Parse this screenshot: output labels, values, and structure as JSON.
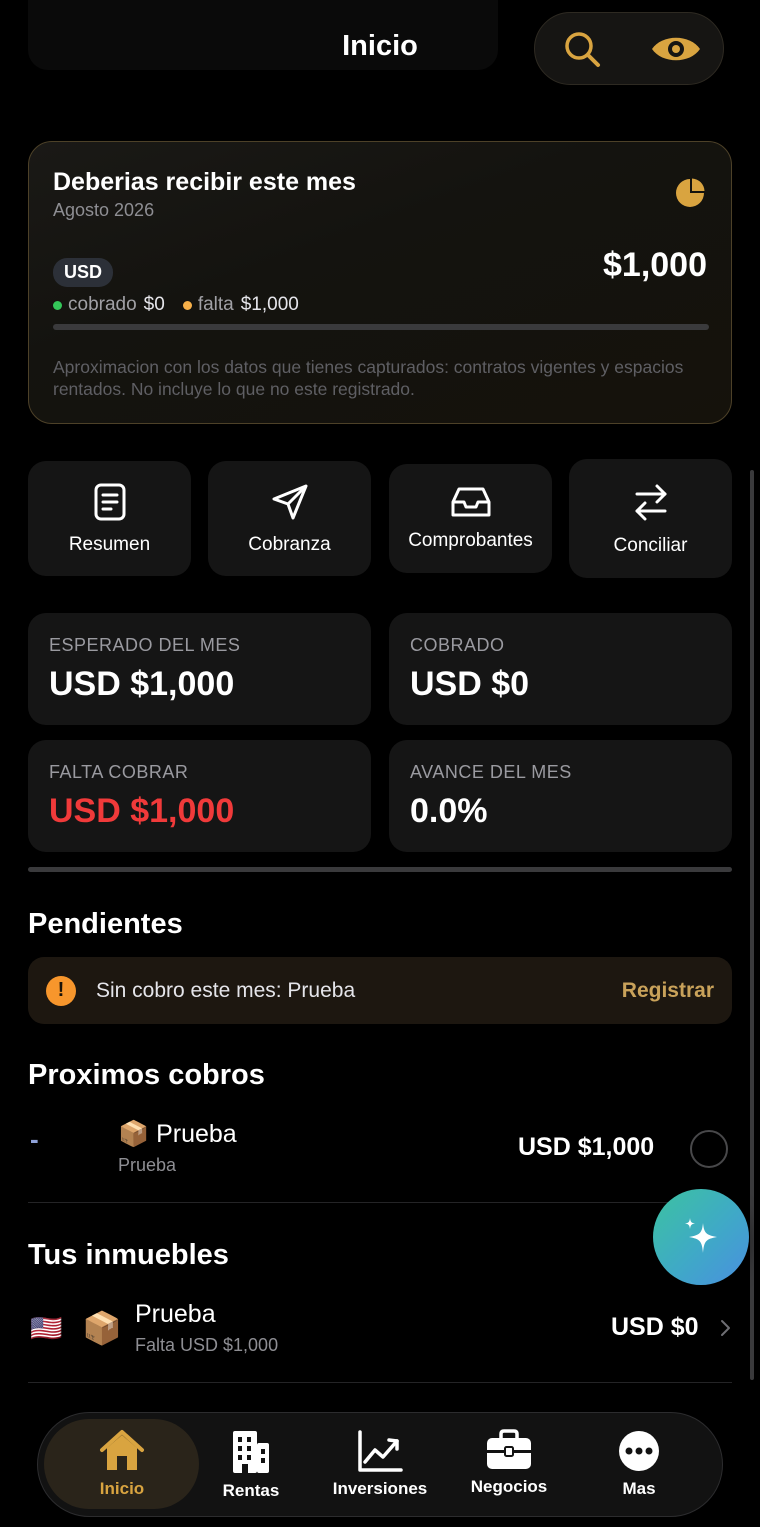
{
  "header": {
    "title": "Inicio",
    "search_icon": "search-icon",
    "visibility_icon": "eye-icon",
    "accent": "#d9a440"
  },
  "summary_card": {
    "title": "Deberias recibir este mes",
    "subtitle": "Agosto 2026",
    "currency": "USD",
    "amount": "$1,000",
    "legend": {
      "collected_label": "cobrado",
      "collected_value": "$0",
      "collected_color": "#34c759",
      "missing_label": "falta",
      "missing_value": "$1,000",
      "missing_color": "#f7b049"
    },
    "progress_fraction": 0,
    "note": "Aproximacion con los datos que tienes capturados: contratos vigentes y espacios rentados. No incluye lo que no este registrado."
  },
  "quick_actions": [
    {
      "label": "Resumen",
      "icon": "document-icon"
    },
    {
      "label": "Cobranza",
      "icon": "send-icon"
    },
    {
      "label": "Comprobantes",
      "icon": "inbox-icon"
    },
    {
      "label": "Conciliar",
      "icon": "swap-icon"
    }
  ],
  "stats": [
    {
      "label": "ESPERADO DEL MES",
      "value": "USD $1,000"
    },
    {
      "label": "COBRADO",
      "value": "USD $0"
    },
    {
      "label": "FALTA COBRAR",
      "value": "USD $1,000",
      "color": "#f03a3a"
    },
    {
      "label": "AVANCE DEL MES",
      "value": "0.0%"
    }
  ],
  "pending": {
    "title": "Pendientes",
    "message": "Sin cobro este mes: Prueba",
    "action": "Registrar"
  },
  "upcoming": {
    "title": "Proximos cobros",
    "items": [
      {
        "marker": "-",
        "emoji": "📦",
        "name": "Prueba",
        "sub": "Prueba",
        "amount": "USD $1,000"
      }
    ]
  },
  "properties": {
    "title": "Tus inmuebles",
    "items": [
      {
        "flag": "🇺🇸",
        "emoji": "📦",
        "name": "Prueba",
        "sub": "Falta USD $1,000",
        "amount": "USD $0"
      }
    ]
  },
  "tabbar": {
    "active": "Inicio",
    "tabs": [
      {
        "label": "Inicio",
        "icon": "home-icon"
      },
      {
        "label": "Rentas",
        "icon": "building-icon"
      },
      {
        "label": "Inversiones",
        "icon": "chart-icon"
      },
      {
        "label": "Negocios",
        "icon": "briefcase-icon"
      },
      {
        "label": "Mas",
        "icon": "more-icon"
      }
    ]
  }
}
